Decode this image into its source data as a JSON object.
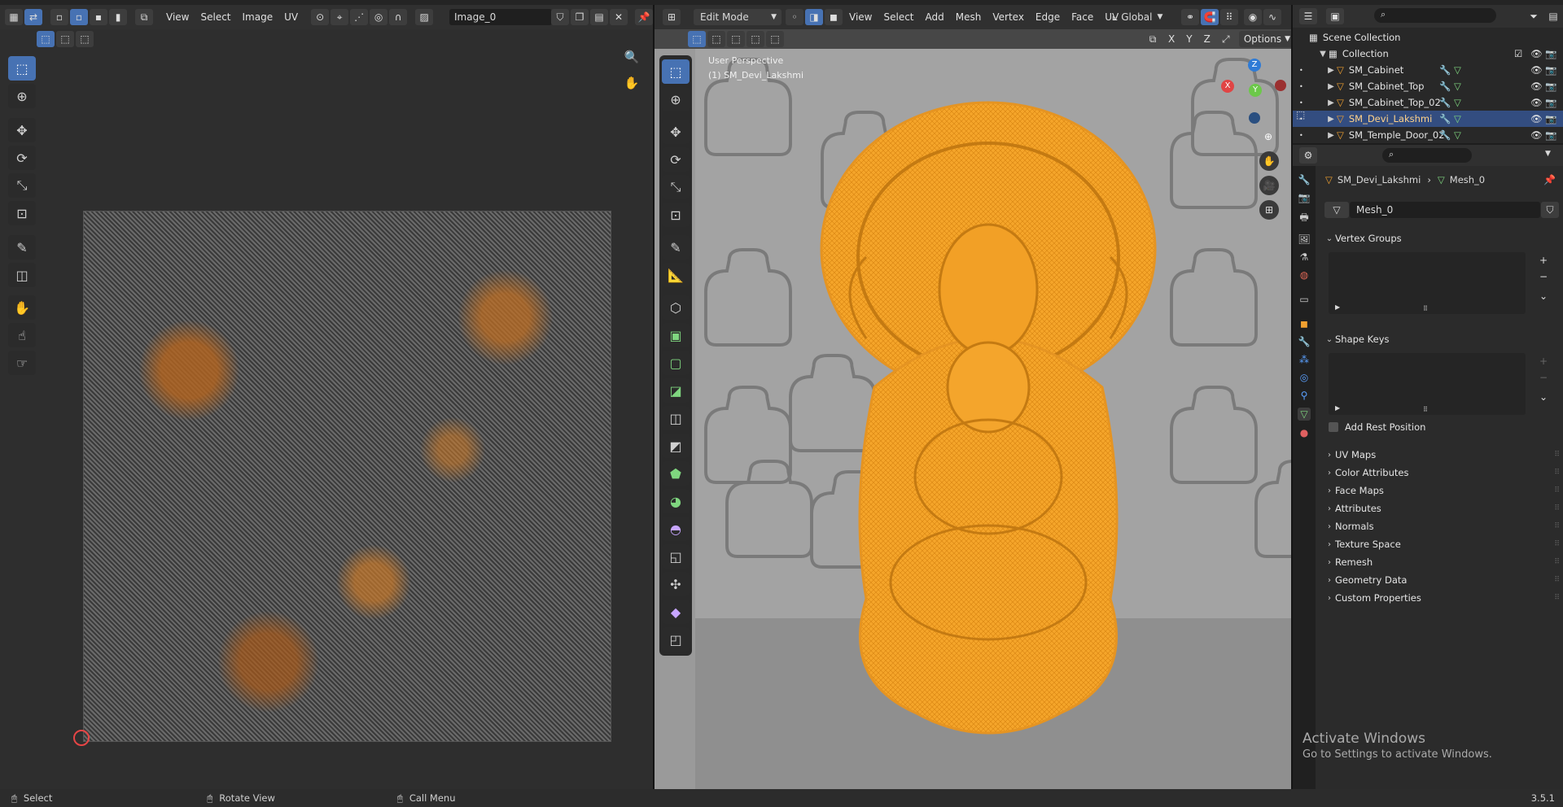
{
  "uv_editor": {
    "menus": [
      "View",
      "Select",
      "Image",
      "UV"
    ],
    "image_name": "Image_0"
  },
  "viewport": {
    "mode": "Edit Mode",
    "menus": [
      "View",
      "Select",
      "Add",
      "Mesh",
      "Vertex",
      "Edge",
      "Face",
      "UV"
    ],
    "transform_orientation": "Global",
    "axis_x": "X",
    "axis_y": "Y",
    "axis_z": "Z",
    "options_label": "Options",
    "perspective_label": "User Perspective",
    "object_label": "(1) SM_Devi_Lakshmi",
    "gizmo": {
      "x": "X",
      "y": "Y",
      "z": "Z"
    }
  },
  "outliner": {
    "scene_collection": "Scene Collection",
    "collection": "Collection",
    "items": [
      {
        "name": "SM_Cabinet",
        "selected": false
      },
      {
        "name": "SM_Cabinet_Top",
        "selected": false
      },
      {
        "name": "SM_Cabinet_Top_02",
        "selected": false
      },
      {
        "name": "SM_Devi_Lakshmi",
        "selected": true
      },
      {
        "name": "SM_Temple_Door_02",
        "selected": false
      }
    ]
  },
  "properties": {
    "breadcrumb_object": "SM_Devi_Lakshmi",
    "breadcrumb_mesh": "Mesh_0",
    "mesh_name": "Mesh_0",
    "panels_open": [
      "Vertex Groups",
      "Shape Keys"
    ],
    "add_rest_position": "Add Rest Position",
    "panels_closed": [
      "UV Maps",
      "Color Attributes",
      "Face Maps",
      "Attributes",
      "Normals",
      "Texture Space",
      "Remesh",
      "Geometry Data",
      "Custom Properties"
    ]
  },
  "watermark": {
    "title": "Activate Windows",
    "subtitle": "Go to Settings to activate Windows."
  },
  "statusbar": {
    "select": "Select",
    "rotate": "Rotate View",
    "call_menu": "Call Menu",
    "version": "3.5.1"
  },
  "colors": {
    "accent": "#4772b3",
    "mesh_orange": "#f5a52a",
    "selected_row": "#334d80"
  }
}
